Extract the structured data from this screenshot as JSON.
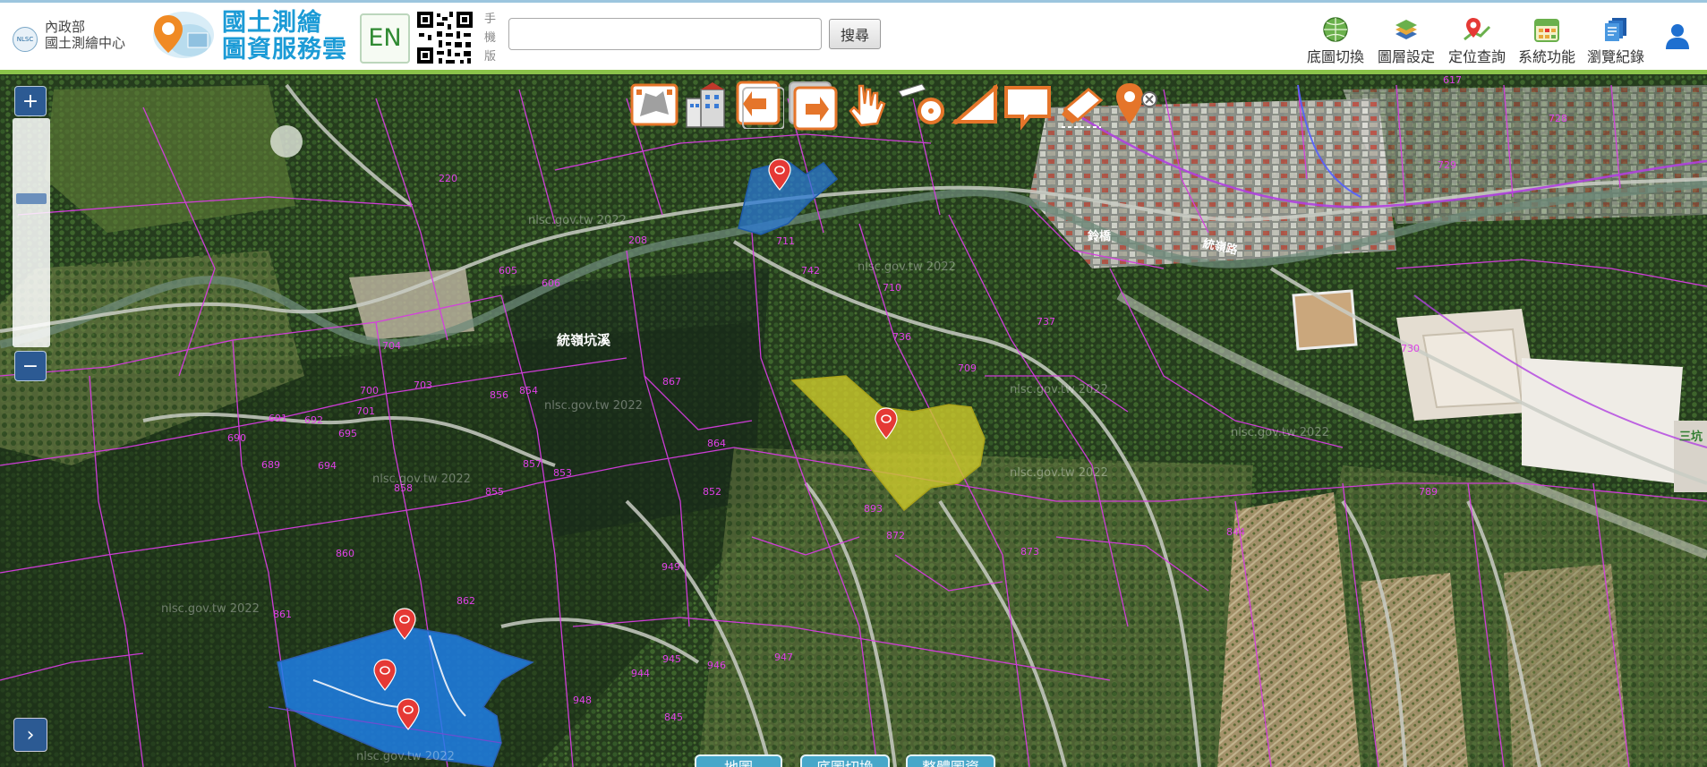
{
  "header": {
    "org_logo_text": "NLSC",
    "org_line1": "內政部",
    "org_line2": "國土測繪中心",
    "brand_line1": "國土測繪",
    "brand_line2": "圖資服務雲",
    "lang_button": "EN",
    "mobile_label": "手機版",
    "search_placeholder": "",
    "search_button": "搜尋",
    "nav": [
      {
        "label": "底圖切換",
        "icon": "globe-icon"
      },
      {
        "label": "圖層設定",
        "icon": "layers-icon"
      },
      {
        "label": "定位查詢",
        "icon": "locate-icon"
      },
      {
        "label": "系統功能",
        "icon": "calendar-grid-icon"
      },
      {
        "label": "瀏覽紀錄",
        "icon": "history-icon"
      },
      {
        "label": "",
        "icon": "user-icon"
      }
    ]
  },
  "map": {
    "zoom_in": "+",
    "zoom_out": "−",
    "expand": "›",
    "tools": [
      "full-extent-icon",
      "building-icon",
      "previous-view-icon",
      "next-view-icon",
      "pan-hand-icon",
      "measure-area-icon",
      "measure-angle-icon",
      "draw-rectangle-icon",
      "eraser-icon",
      "clear-pin-icon"
    ],
    "labels": {
      "creek": "統嶺坑溪",
      "road": "統嶺路",
      "bridge": "鈴橋",
      "side": "三坑"
    },
    "watermark": "nlsc.gov.tw 2022",
    "parcel_numbers": [
      {
        "n": "220"
      },
      {
        "n": "208"
      },
      {
        "n": "605"
      },
      {
        "n": "606"
      },
      {
        "n": "704"
      },
      {
        "n": "700"
      },
      {
        "n": "703"
      },
      {
        "n": "701"
      },
      {
        "n": "695"
      },
      {
        "n": "691"
      },
      {
        "n": "692"
      },
      {
        "n": "690"
      },
      {
        "n": "689"
      },
      {
        "n": "694"
      },
      {
        "n": "856"
      },
      {
        "n": "857"
      },
      {
        "n": "853"
      },
      {
        "n": "854"
      },
      {
        "n": "855"
      },
      {
        "n": "858"
      },
      {
        "n": "860"
      },
      {
        "n": "861"
      },
      {
        "n": "862"
      },
      {
        "n": "864"
      },
      {
        "n": "852"
      },
      {
        "n": "867"
      },
      {
        "n": "709"
      },
      {
        "n": "710"
      },
      {
        "n": "736"
      },
      {
        "n": "737"
      },
      {
        "n": "742"
      },
      {
        "n": "711"
      },
      {
        "n": "617"
      },
      {
        "n": "728"
      },
      {
        "n": "729"
      },
      {
        "n": "730"
      },
      {
        "n": "789"
      },
      {
        "n": "844"
      },
      {
        "n": "845"
      },
      {
        "n": "944"
      },
      {
        "n": "945"
      },
      {
        "n": "946"
      },
      {
        "n": "947"
      },
      {
        "n": "948"
      },
      {
        "n": "949"
      },
      {
        "n": "893"
      },
      {
        "n": "872"
      },
      {
        "n": "873"
      },
      {
        "n": "877"
      }
    ],
    "bottom_tabs": [
      "地圖",
      "底圖切換",
      "整體圖資"
    ]
  }
}
